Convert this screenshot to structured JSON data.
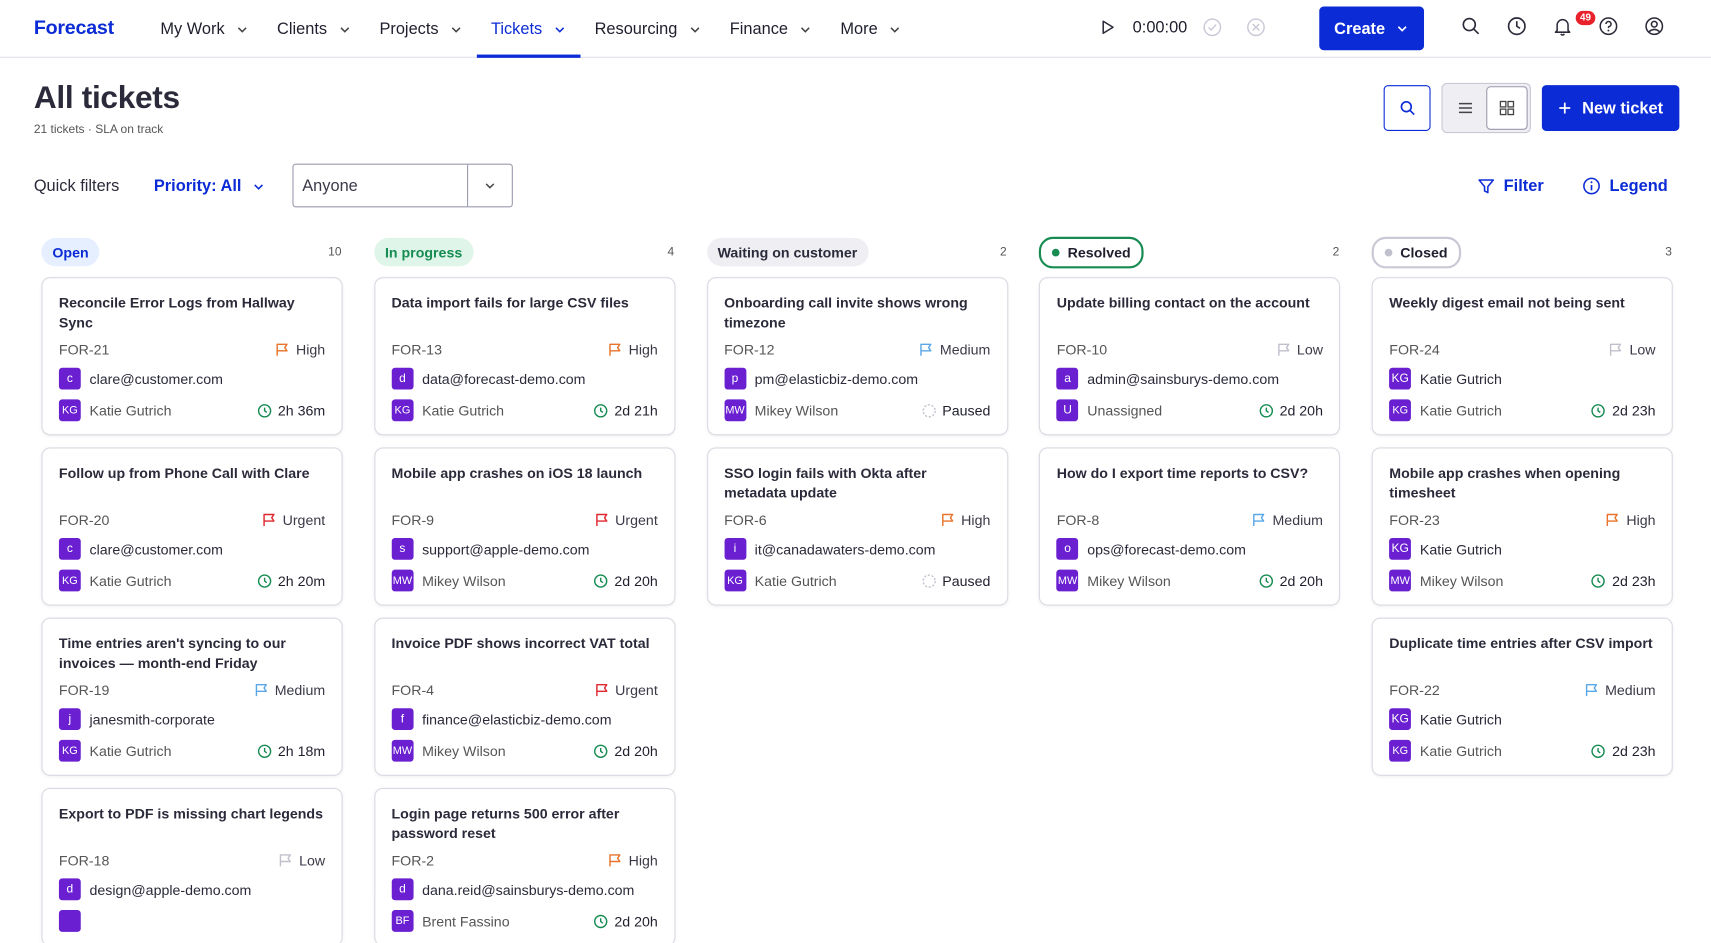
{
  "app": {
    "logo": "Forecast"
  },
  "nav": {
    "items": [
      {
        "label": "My Work"
      },
      {
        "label": "Clients"
      },
      {
        "label": "Projects"
      },
      {
        "label": "Tickets",
        "active": true
      },
      {
        "label": "Resourcing"
      },
      {
        "label": "Finance"
      },
      {
        "label": "More"
      }
    ],
    "timer": "0:00:00",
    "create_label": "Create",
    "notification_count": "49"
  },
  "page": {
    "title": "All tickets",
    "subtitle": "21 tickets · SLA on track",
    "new_ticket_label": "New ticket"
  },
  "filters": {
    "quick_label": "Quick filters",
    "priority_label": "Priority: All",
    "assignee_value": "Anyone",
    "filter_label": "Filter",
    "legend_label": "Legend"
  },
  "colors": {
    "accent": "#0b2bd6",
    "avatar": "#6a1fd1",
    "high": "#e8732a",
    "urgent": "#e0262f",
    "medium": "#5aa7e8",
    "low": "#c0c0cc",
    "sla": "#178c52"
  },
  "columns": [
    {
      "name": "Open",
      "count": "10",
      "cards": [
        {
          "title": "Reconcile Error Logs from Hallway Sync",
          "id": "FOR-21",
          "priority": "High",
          "contact_initial": "c",
          "contact": "clare@customer.com",
          "assignee_initials": "KG",
          "assignee": "Katie Gutrich",
          "sla": "2h 36m"
        },
        {
          "title": "Follow up from Phone Call with Clare",
          "id": "FOR-20",
          "priority": "Urgent",
          "contact_initial": "c",
          "contact": "clare@customer.com",
          "assignee_initials": "KG",
          "assignee": "Katie Gutrich",
          "sla": "2h 20m"
        },
        {
          "title": "Time entries aren't syncing to our invoices — month-end Friday",
          "id": "FOR-19",
          "priority": "Medium",
          "contact_initial": "j",
          "contact": "janesmith-corporate",
          "assignee_initials": "KG",
          "assignee": "Katie Gutrich",
          "sla": "2h 18m"
        },
        {
          "title": "Export to PDF is missing chart legends",
          "id": "FOR-18",
          "priority": "Low",
          "contact_initial": "d",
          "contact": "design@apple-demo.com",
          "assignee_initials": "",
          "assignee": "",
          "sla": ""
        }
      ]
    },
    {
      "name": "In progress",
      "count": "4",
      "cards": [
        {
          "title": "Data import fails for large CSV files",
          "id": "FOR-13",
          "priority": "High",
          "contact_initial": "d",
          "contact": "data@forecast-demo.com",
          "assignee_initials": "KG",
          "assignee": "Katie Gutrich",
          "sla": "2d 21h"
        },
        {
          "title": "Mobile app crashes on iOS 18 launch",
          "id": "FOR-9",
          "priority": "Urgent",
          "contact_initial": "s",
          "contact": "support@apple-demo.com",
          "assignee_initials": "MW",
          "assignee": "Mikey Wilson",
          "sla": "2d 20h"
        },
        {
          "title": "Invoice PDF shows incorrect VAT total",
          "id": "FOR-4",
          "priority": "Urgent",
          "contact_initial": "f",
          "contact": "finance@elasticbiz-demo.com",
          "assignee_initials": "MW",
          "assignee": "Mikey Wilson",
          "sla": "2d 20h"
        },
        {
          "title": "Login page returns 500 error after password reset",
          "id": "FOR-2",
          "priority": "High",
          "contact_initial": "d",
          "contact": "dana.reid@sainsburys-demo.com",
          "assignee_initials": "BF",
          "assignee": "Brent Fassino",
          "sla": "2d 20h"
        }
      ]
    },
    {
      "name": "Waiting on customer",
      "count": "2",
      "cards": [
        {
          "title": "Onboarding call invite shows wrong timezone",
          "id": "FOR-12",
          "priority": "Medium",
          "contact_initial": "p",
          "contact": "pm@elasticbiz-demo.com",
          "assignee_initials": "MW",
          "assignee": "Mikey Wilson",
          "sla": "Paused"
        },
        {
          "title": "SSO login fails with Okta after metadata update",
          "id": "FOR-6",
          "priority": "High",
          "contact_initial": "i",
          "contact": "it@canadawaters-demo.com",
          "assignee_initials": "KG",
          "assignee": "Katie Gutrich",
          "sla": "Paused"
        }
      ]
    },
    {
      "name": "Resolved",
      "count": "2",
      "cards": [
        {
          "title": "Update billing contact on the account",
          "id": "FOR-10",
          "priority": "Low",
          "contact_initial": "a",
          "contact": "admin@sainsburys-demo.com",
          "assignee_initials": "U",
          "assignee": "Unassigned",
          "sla": "2d 20h"
        },
        {
          "title": "How do I export time reports to CSV?",
          "id": "FOR-8",
          "priority": "Medium",
          "contact_initial": "o",
          "contact": "ops@forecast-demo.com",
          "assignee_initials": "MW",
          "assignee": "Mikey Wilson",
          "sla": "2d 20h"
        }
      ]
    },
    {
      "name": "Closed",
      "count": "3",
      "cards": [
        {
          "title": "Weekly digest email not being sent",
          "id": "FOR-24",
          "priority": "Low",
          "contact_initial": "KG",
          "contact": "Katie Gutrich",
          "assignee_initials": "KG",
          "assignee": "Katie Gutrich",
          "sla": "2d 23h"
        },
        {
          "title": "Mobile app crashes when opening timesheet",
          "id": "FOR-23",
          "priority": "High",
          "contact_initial": "KG",
          "contact": "Katie Gutrich",
          "assignee_initials": "MW",
          "assignee": "Mikey Wilson",
          "sla": "2d 23h"
        },
        {
          "title": "Duplicate time entries after CSV import",
          "id": "FOR-22",
          "priority": "Medium",
          "contact_initial": "KG",
          "contact": "Katie Gutrich",
          "assignee_initials": "KG",
          "assignee": "Katie Gutrich",
          "sla": "2d 23h"
        }
      ]
    }
  ]
}
